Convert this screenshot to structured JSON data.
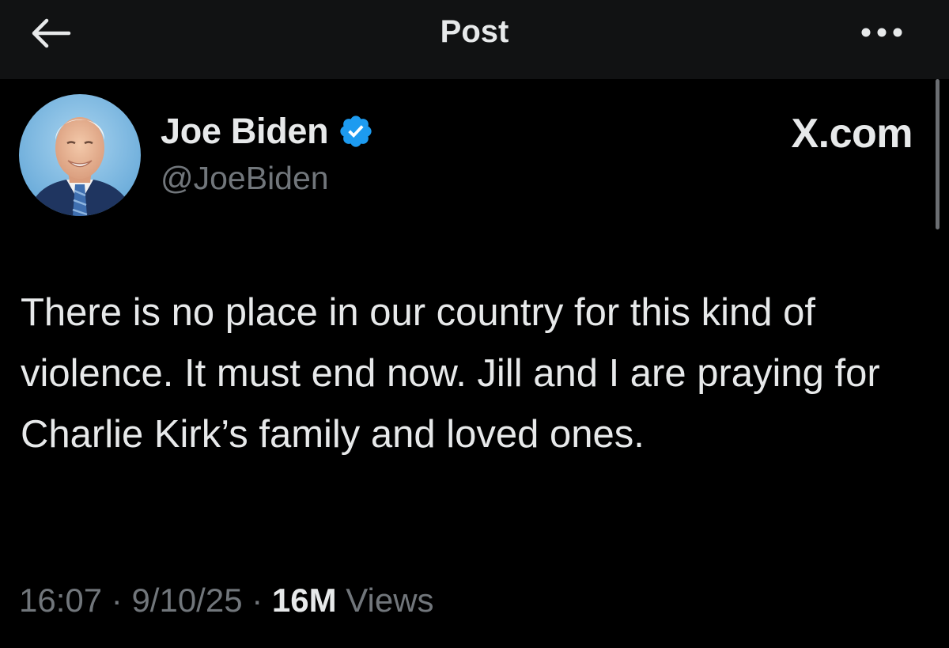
{
  "header": {
    "title": "Post",
    "back_icon": "back-arrow-icon",
    "more_icon": "more-options-icon"
  },
  "post": {
    "author": {
      "display_name": "Joe Biden",
      "handle": "@JoeBiden",
      "verified": true,
      "verified_color": "#1d9bf0",
      "avatar": "avatar-photo"
    },
    "brand_label": "X.com",
    "text": "There is no place in our country for this kind of violence. It must end now. Jill and I are praying for Charlie Kirk’s family and loved ones.",
    "meta": {
      "time": "16:07",
      "date": "9/10/25",
      "separator": " · ",
      "views_count": "16M",
      "views_label": " Views"
    }
  },
  "colors": {
    "background": "#000000",
    "header_background": "#111213",
    "primary_text": "#e7e9ea",
    "secondary_text": "#71767b",
    "accent": "#1d9bf0"
  }
}
